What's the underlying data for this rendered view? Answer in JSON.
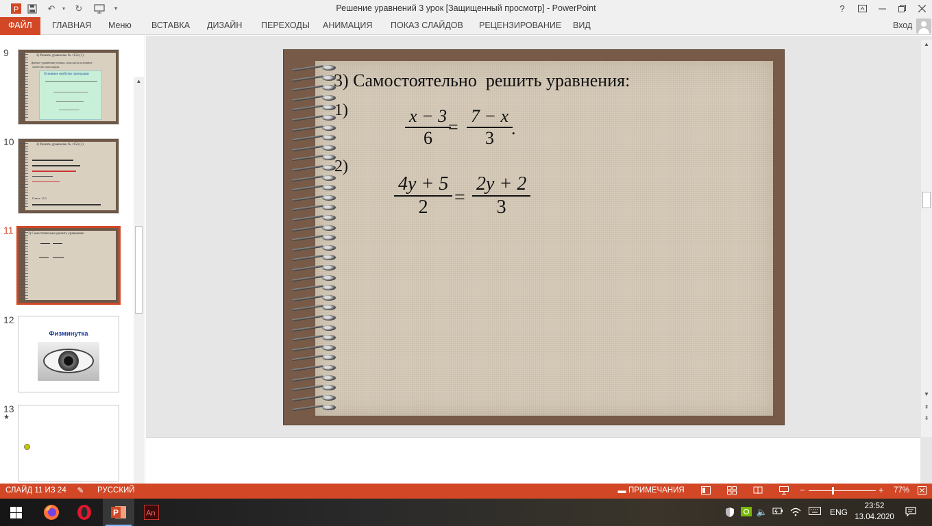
{
  "window": {
    "title": "Решение уравнений 3 урок [Защищенный просмотр] - PowerPoint",
    "help": "?",
    "quick_access": [
      "save-icon",
      "undo-icon",
      "redo-icon",
      "start-slideshow-icon",
      "customize-icon"
    ]
  },
  "ribbon": {
    "tabs": [
      "ФАЙЛ",
      "ГЛАВНАЯ",
      "Меню",
      "ВСТАВКА",
      "ДИЗАЙН",
      "ПЕРЕХОДЫ",
      "АНИМАЦИЯ",
      "ПОКАЗ СЛАЙДОВ",
      "РЕЦЕНЗИРОВАНИЕ",
      "ВИД"
    ],
    "signin": "Вход"
  },
  "thumbnails": [
    {
      "number": "9",
      "title": "2) Решить уравнение № 1154 (1)",
      "subtitle1": "Данное уравнение решим, используя основное",
      "subtitle2": "свойство пропорции.",
      "box_title": "Основное свойство пропорции"
    },
    {
      "number": "10",
      "title": "2) Решить уравнение № 1154 (1)",
      "answer": "Ответ: -0,5"
    },
    {
      "number": "11",
      "title": "3) Самостоятельно решить уравнения:",
      "selected": true
    },
    {
      "number": "12",
      "title": "Физминутка"
    },
    {
      "number": "13",
      "marker": "★"
    }
  ],
  "slide": {
    "title": "3) Самостоятельно  решить уравнения:",
    "eq1": {
      "label": "1)",
      "lhs_num": "x − 3",
      "lhs_den": "6",
      "eq": "=",
      "rhs_num": "7 − x",
      "rhs_den": "3",
      "end": "."
    },
    "eq2": {
      "label": "2)",
      "lhs_num": "4y + 5",
      "lhs_den": "2",
      "eq": "=",
      "rhs_num": "2y + 2",
      "rhs_den": "3"
    }
  },
  "status": {
    "slide_info": "СЛАЙД 11 ИЗ 24",
    "language": "РУССКИЙ",
    "notes": "ПРИМЕЧАНИЯ",
    "zoom_minus": "−",
    "zoom_plus": "+",
    "zoom": "77%"
  },
  "taskbar": {
    "apps": [
      "windows-start-icon",
      "firefox-icon",
      "opera-icon",
      "powerpoint-icon",
      "animate-icon"
    ],
    "app_labels": {
      "powerpoint": "P",
      "animate": "An"
    },
    "language": "ENG",
    "time": "23:52",
    "date": "13.04.2020"
  },
  "colors": {
    "accent": "#d24726",
    "slide_frame": "#775a47",
    "slide_paper": "#d6cbba"
  }
}
